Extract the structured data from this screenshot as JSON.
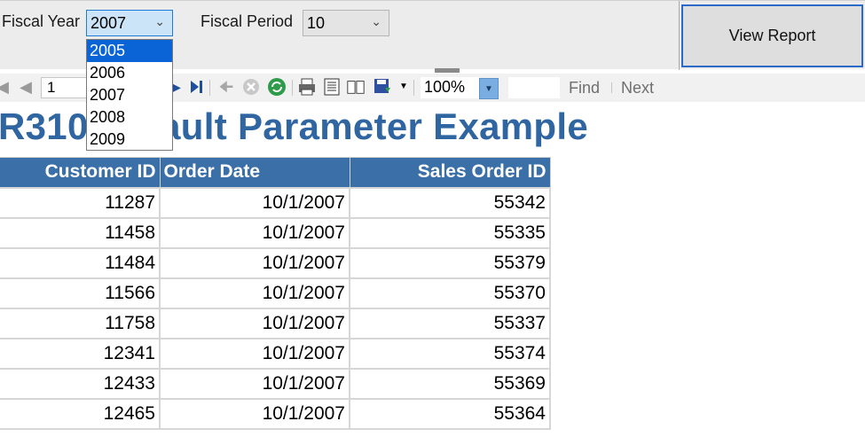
{
  "params": {
    "fiscal_year_label": "Fiscal Year",
    "fiscal_year_value": "2007",
    "fiscal_period_label": "Fiscal Period",
    "fiscal_period_value": "10",
    "year_options": [
      "2005",
      "2006",
      "2007",
      "2008",
      "2009"
    ],
    "highlighted_option": "2005"
  },
  "view_report_label": "View Report",
  "toolbar": {
    "page_number": "1",
    "zoom": "100%",
    "find_label": "Find",
    "next_label": "Next"
  },
  "report": {
    "title": "R310 Default Parameter Example",
    "headers": [
      "Customer ID",
      "Order Date",
      "Sales Order ID"
    ],
    "rows": [
      [
        "11287",
        "10/1/2007",
        "55342"
      ],
      [
        "11458",
        "10/1/2007",
        "55335"
      ],
      [
        "11484",
        "10/1/2007",
        "55379"
      ],
      [
        "11566",
        "10/1/2007",
        "55370"
      ],
      [
        "11758",
        "10/1/2007",
        "55337"
      ],
      [
        "12341",
        "10/1/2007",
        "55374"
      ],
      [
        "12433",
        "10/1/2007",
        "55369"
      ],
      [
        "12465",
        "10/1/2007",
        "55364"
      ]
    ]
  },
  "colors": {
    "accent": "#3b6fa8",
    "title": "#2f65a0",
    "selection": "#0a64d6"
  }
}
